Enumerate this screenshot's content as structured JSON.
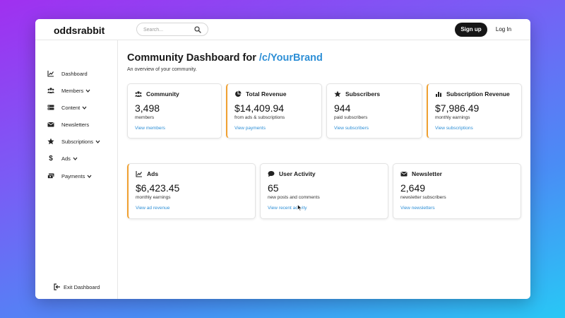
{
  "app": {
    "logo": "oddsrabbit"
  },
  "header": {
    "search_placeholder": "Search...",
    "signup_label": "Sign up",
    "login_label": "Log In"
  },
  "sidebar": {
    "items": [
      {
        "label": "Dashboard",
        "icon": "chart-line-icon"
      },
      {
        "label": "Members",
        "icon": "users-icon",
        "has_dropdown": true
      },
      {
        "label": "Content",
        "icon": "content-icon",
        "has_dropdown": true
      },
      {
        "label": "Newsletters",
        "icon": "envelope-icon"
      },
      {
        "label": "Subscriptions",
        "icon": "star-icon",
        "has_dropdown": true
      },
      {
        "label": "Ads",
        "icon": "dollar-icon",
        "has_dropdown": true
      },
      {
        "label": "Payments",
        "icon": "money-icon",
        "has_dropdown": true
      }
    ],
    "exit_label": "Exit Dashboard"
  },
  "main": {
    "title_prefix": "Community Dashboard for ",
    "title_brand": "/c/YourBrand",
    "subtitle": "An overview of your community.",
    "cards": [
      {
        "title": "Community",
        "value": "3,498",
        "desc": "members",
        "link": "View members",
        "icon": "users-icon",
        "accent": false
      },
      {
        "title": "Total Revenue",
        "value": "$14,409.94",
        "desc": "from ads & subscriptions",
        "link": "View payments",
        "icon": "pie-chart-icon",
        "accent": true
      },
      {
        "title": "Subscribers",
        "value": "944",
        "desc": "paid subscribers",
        "link": "View subscribers",
        "icon": "star-icon",
        "accent": false
      },
      {
        "title": "Subscription Revenue",
        "value": "$7,986.49",
        "desc": "monthly earnings",
        "link": "View subscriptions",
        "icon": "bar-chart-icon",
        "accent": true
      },
      {
        "title": "Ads",
        "value": "$6,423.45",
        "desc": "monthly earnings",
        "link": "View ad revenue",
        "icon": "chart-line-icon",
        "accent": true
      },
      {
        "title": "User Activity",
        "value": "65",
        "desc": "new posts and comments",
        "link": "View recent activity",
        "icon": "comment-icon",
        "accent": false
      },
      {
        "title": "Newsletter",
        "value": "2,649",
        "desc": "newsletter subscribers",
        "link": "View newsletters",
        "icon": "envelope-icon",
        "accent": false
      }
    ]
  },
  "colors": {
    "accent": "#f0a030",
    "link": "#2e8fd6",
    "primary_button": "#161616"
  }
}
